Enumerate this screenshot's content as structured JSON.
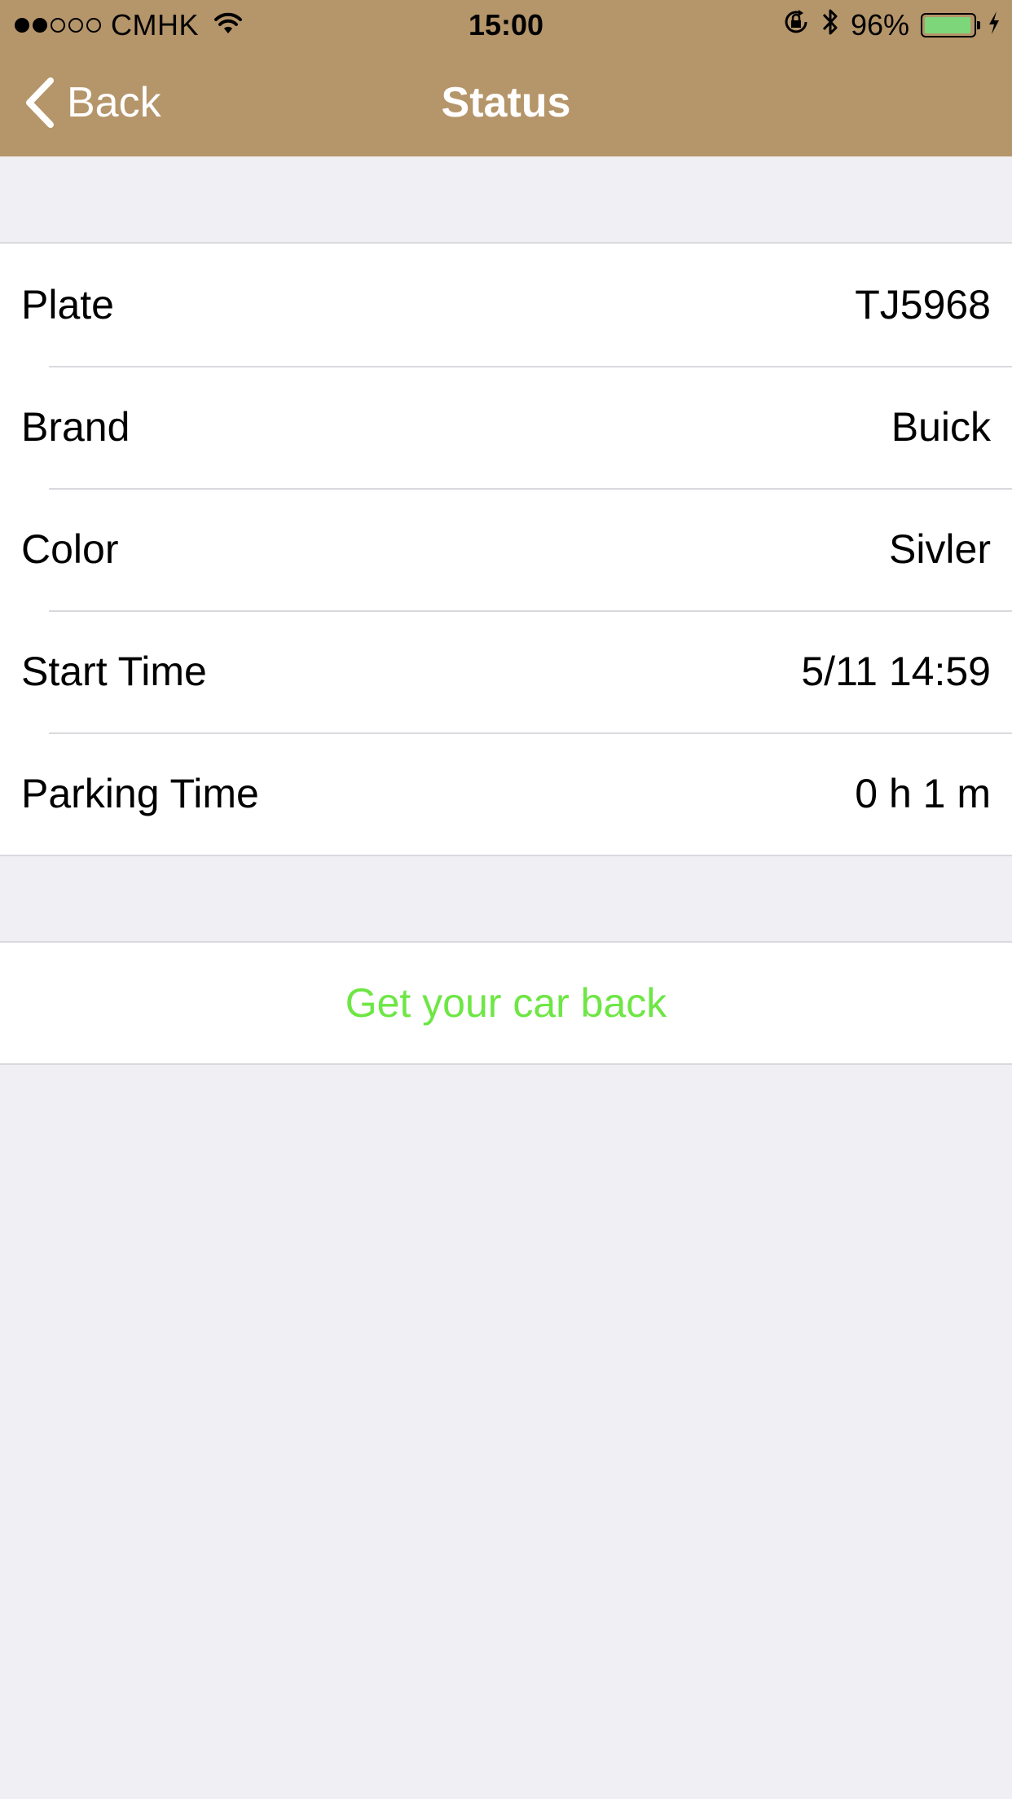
{
  "status_bar": {
    "carrier": "CMHK",
    "time": "15:00",
    "battery_percent": "96%",
    "battery_level": 0.96,
    "battery_color": "#7dd67a",
    "signal_bars_filled": 2,
    "signal_bars_total": 5
  },
  "nav": {
    "back_label": "Back",
    "title": "Status",
    "bar_color": "#b5956a"
  },
  "details": {
    "rows": [
      {
        "label": "Plate",
        "value": "TJ5968"
      },
      {
        "label": "Brand",
        "value": "Buick"
      },
      {
        "label": "Color",
        "value": "Sivler"
      },
      {
        "label": "Start Time",
        "value": "5/11 14:59"
      },
      {
        "label": "Parking Time",
        "value": "0 h 1 m"
      }
    ]
  },
  "action": {
    "label": "Get your car back",
    "color": "#6ee645"
  },
  "icons": {
    "back": "chevron-left-icon",
    "wifi": "wifi-icon",
    "rotation_lock": "rotation-lock-icon",
    "bluetooth": "bluetooth-icon",
    "battery": "battery-icon",
    "charging": "charging-bolt-icon"
  }
}
